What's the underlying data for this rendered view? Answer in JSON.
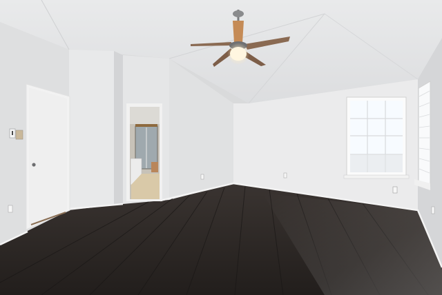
{
  "scene": {
    "kind": "empty-bedroom-photo",
    "colors": {
      "ceiling": "#e6e7e8",
      "wall_light": "#ececed",
      "wall_shade": "#d7d8da",
      "trim": "#f4f4f4",
      "floor_dark": "#2b2624",
      "floor_mid": "#3d3633",
      "floor_sheen": "#6d6764",
      "window_glass": "#f7fbff",
      "fan_blade": "#8a6a52",
      "fan_light": "#fff6e0",
      "bathroom_floor": "#d9c9a8",
      "bathroom_wall": "#c7c2b8"
    },
    "objects": [
      "ceiling-fan-icon",
      "interior-door-icon",
      "bathroom-doorway-icon",
      "window-icon",
      "light-switch-icon",
      "wall-outlet-icon"
    ]
  }
}
